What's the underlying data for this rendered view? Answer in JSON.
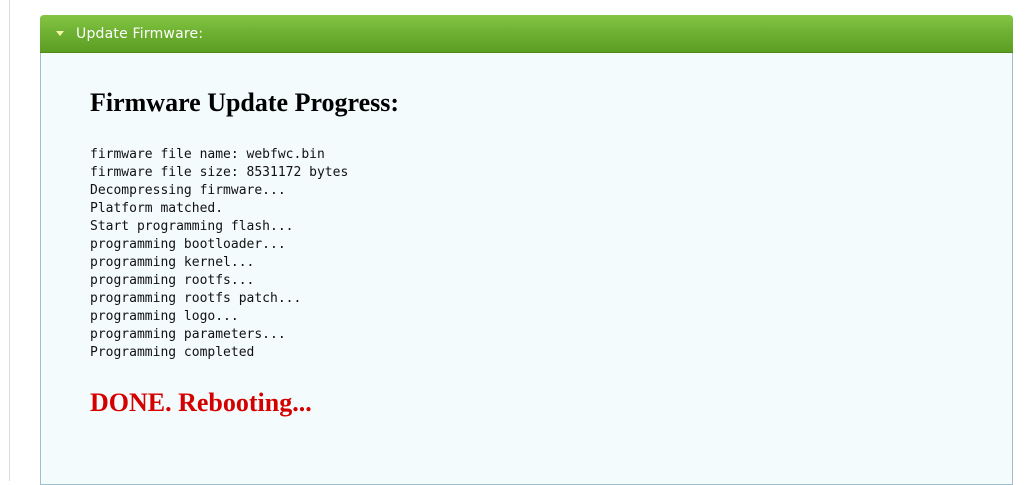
{
  "panel": {
    "header_title": "Update Firmware:",
    "header_color": "#6fb233"
  },
  "progress": {
    "title": "Firmware Update Progress:",
    "log_lines": [
      "firmware file name: webfwc.bin",
      "firmware file size: 8531172 bytes",
      "Decompressing firmware...",
      "Platform matched.",
      "Start programming flash...",
      "programming bootloader...",
      "programming kernel...",
      "programming rootfs...",
      "programming rootfs patch...",
      "programming logo...",
      "programming parameters...",
      "Programming completed"
    ],
    "status": "DONE. Rebooting...",
    "status_color": "#d40000"
  }
}
